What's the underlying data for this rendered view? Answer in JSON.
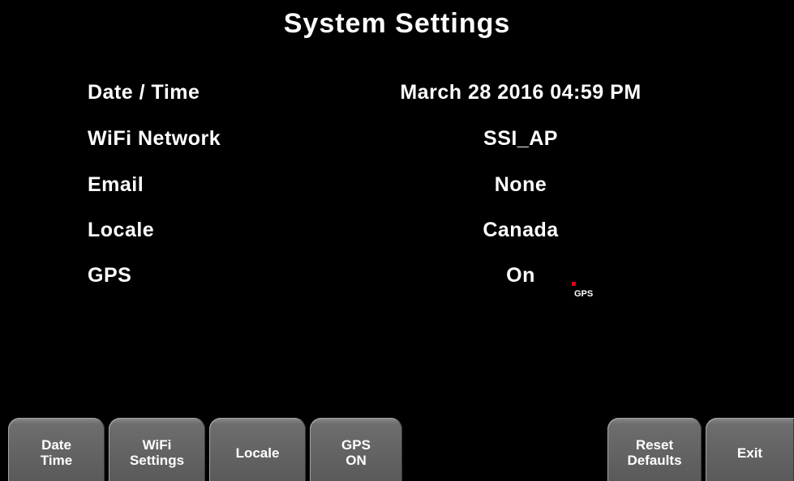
{
  "title": "System Settings",
  "settings": [
    {
      "label": "Date / Time",
      "value": "March 28 2016 04:59 PM"
    },
    {
      "label": "WiFi Network",
      "value": "SSI_AP"
    },
    {
      "label": "Email",
      "value": "None"
    },
    {
      "label": "Locale",
      "value": "Canada"
    },
    {
      "label": "GPS",
      "value": "On"
    }
  ],
  "gps_indicator": {
    "text": "GPS",
    "dot_color": "#e3001b"
  },
  "softkeys": {
    "date_time": "Date\nTime",
    "wifi_settings": "WiFi\nSettings",
    "locale": "Locale",
    "gps_on": "GPS\nON",
    "reset_defaults": "Reset\nDefaults",
    "exit": "Exit"
  },
  "colors": {
    "background": "#000000",
    "text": "#ffffff",
    "softkey": "#6d6d6d"
  }
}
